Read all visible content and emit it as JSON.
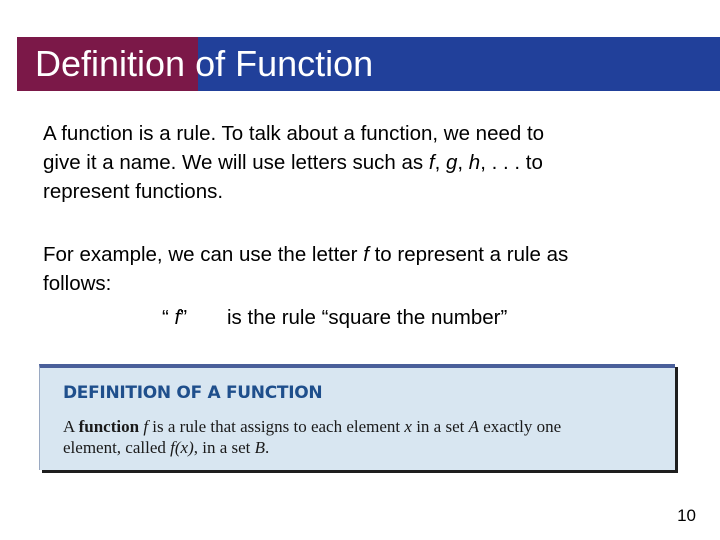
{
  "slide": {
    "title_part1": "Definition",
    "title_part2": " of Function",
    "colors": {
      "title_accent": "#7b1848",
      "title_bar": "#21409a",
      "box_bg": "#d8e6f1",
      "box_title": "#1f4f8c"
    },
    "paragraph1": {
      "line1": "A function is a rule. To talk about a function, we need to",
      "line2_a": "give it a name. We will use letters such as ",
      "var_f": "f",
      "sep1": ", ",
      "var_g": "g",
      "sep2": ", ",
      "var_h": "h",
      "line2_b": ", . . . to",
      "line3": "represent functions."
    },
    "paragraph2": {
      "line1_a": "For example, we can use the letter ",
      "var_f": "f",
      "line1_b": " to represent a rule as",
      "line2": "follows:"
    },
    "rule": {
      "open_quote": "“ ",
      "var_f": "f",
      "close_quote": "”",
      "text": "is the rule   “square the number”"
    },
    "definition_box": {
      "title": "DEFINITION OF A FUNCTION",
      "l1_a": "A ",
      "l1_bold": "function",
      "l1_f": "f",
      "l1_b": " is a rule that assigns to each element ",
      "l1_x": "x",
      "l1_c": " in a set ",
      "l1_A": "A",
      "l1_d": " exactly one",
      "l2_a": "element, called ",
      "l2_fx": "f(x)",
      "l2_b": ", in a set ",
      "l2_B": "B",
      "l2_c": "."
    },
    "page_number": "10"
  }
}
